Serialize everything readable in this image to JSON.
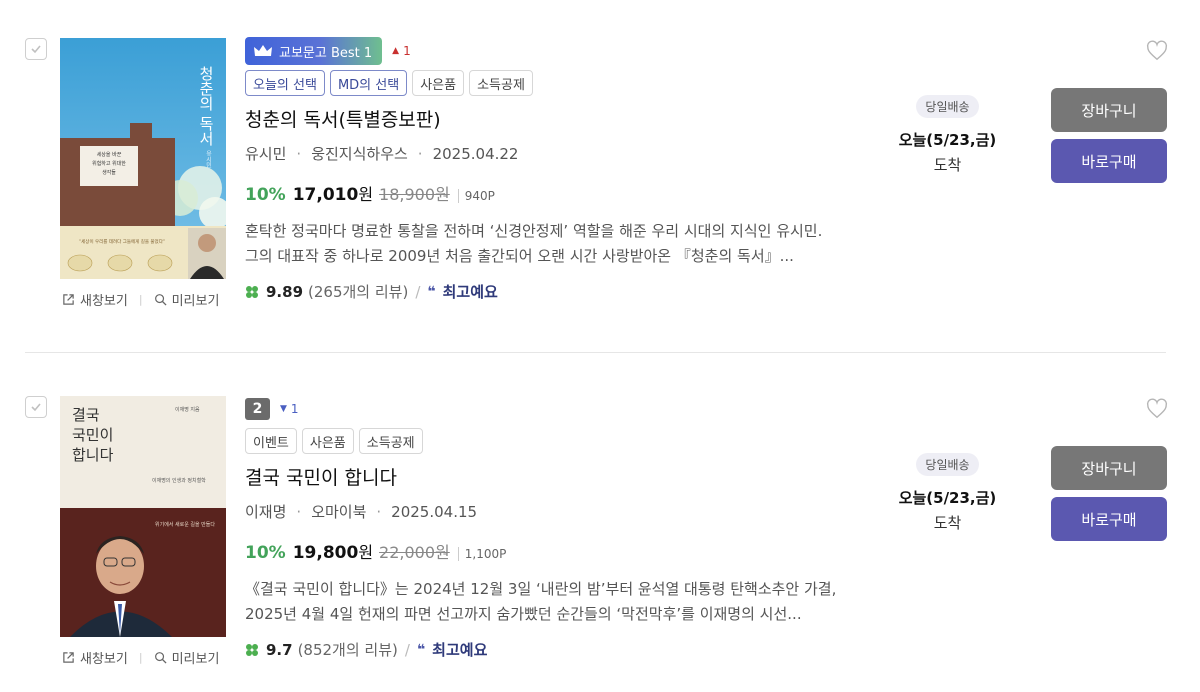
{
  "books": [
    {
      "best_badge": "교보문고 Best 1",
      "rank_number": "",
      "rank_change": "1",
      "rank_direction": "up",
      "tags": [
        "오늘의 선택",
        "MD의 선택",
        "사은품",
        "소득공제"
      ],
      "title": "청춘의 독서(특별증보판)",
      "author": "유시민",
      "publisher": "웅진지식하우스",
      "date": "2025.04.22",
      "discount": "10%",
      "price": "17,010",
      "won": "원",
      "original_price": "18,900원",
      "points": "940P",
      "description": "혼탁한 정국마다 명료한 통찰을 전하며 ‘신경안정제’ 역할을 해준 우리 시대의 지식인 유시민. 그의 대표작 중 하나로 2009년 처음 출간되어 오랜 시간 사랑받아온 『청춘의 독서』...",
      "rating": "9.89",
      "reviews": "(265개의 리뷰)",
      "review_keyword": "최고예요",
      "delivery_badge": "당일배송",
      "delivery_date": "오늘(5/23,금)",
      "delivery_arrive": "도착",
      "cart_label": "장바구니",
      "buy_label": "바로구매",
      "new_window_label": "새창보기",
      "preview_label": "미리보기",
      "cover_text": {
        "title": "청춘의 독서",
        "author": "유시민",
        "label": "세상을 바꾼 위험하고 위대한 생각들",
        "banner": "“세상이 우리를 데려다 그들에게 길을 물었다”"
      }
    },
    {
      "best_badge": "",
      "rank_number": "2",
      "rank_change": "1",
      "rank_direction": "down",
      "tags": [
        "이벤트",
        "사은품",
        "소득공제"
      ],
      "title": "결국 국민이 합니다",
      "author": "이재명",
      "publisher": "오마이북",
      "date": "2025.04.15",
      "discount": "10%",
      "price": "19,800",
      "won": "원",
      "original_price": "22,000원",
      "points": "1,100P",
      "description": "《결국 국민이 합니다》는 2024년 12월 3일 ‘내란의 밤’부터 윤석열 대통령 탄핵소추안 가결, 2025년 4월 4일 헌재의 파면 선고까지 숨가빴던 순간들의 ‘막전막후’를 이재명의 시선...",
      "rating": "9.7",
      "reviews": "(852개의 리뷰)",
      "review_keyword": "최고예요",
      "delivery_badge": "당일배송",
      "delivery_date": "오늘(5/23,금)",
      "delivery_arrive": "도착",
      "cart_label": "장바구니",
      "buy_label": "바로구매",
      "new_window_label": "새창보기",
      "preview_label": "미리보기",
      "cover_text": {
        "title_line1": "결국",
        "title_line2": "국민이",
        "title_line3": "합니다",
        "author": "이재명 지음",
        "subtitle": "이재명의 인생과 정치철학",
        "tagline": "위기에서 새로운 길을 만들다"
      }
    }
  ],
  "colors": {
    "discount": "#43a35a",
    "buy_button": "#5b58b0",
    "cart_button": "#777777",
    "rank_up": "#c8302f",
    "rank_down": "#4a5fc1"
  }
}
